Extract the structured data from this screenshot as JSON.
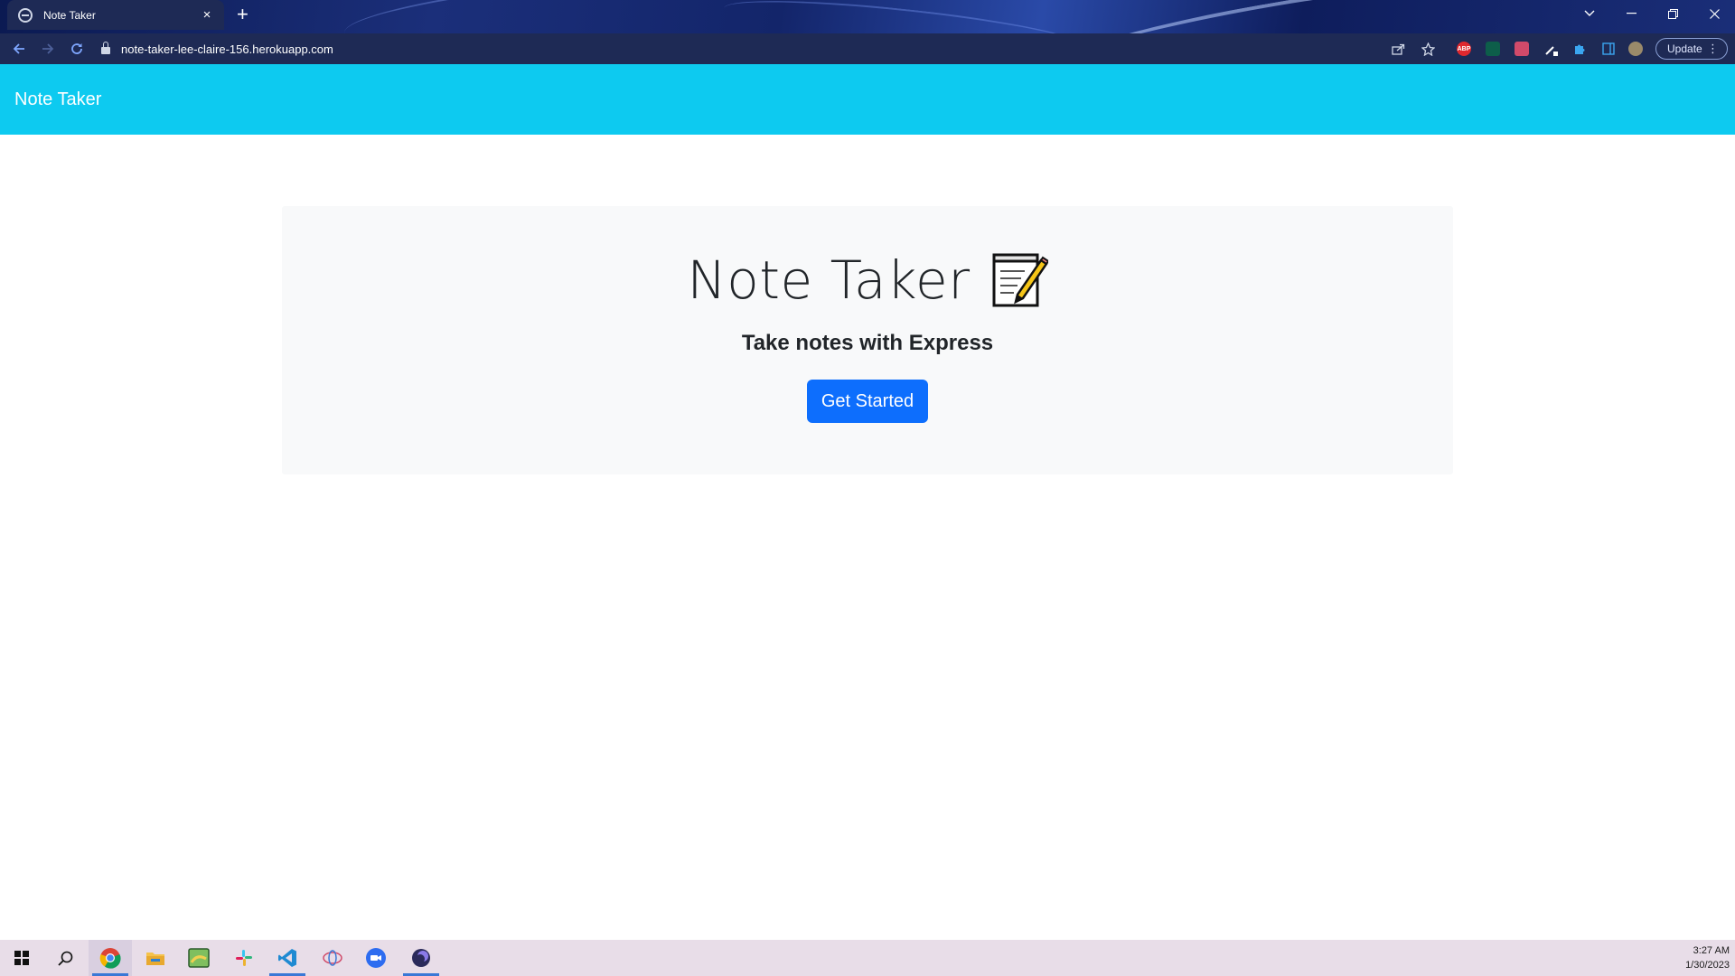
{
  "browser": {
    "tab_title": "Note Taker",
    "tab_close": "×",
    "new_tab": "+",
    "url": "note-taker-lee-claire-156.herokuapp.com",
    "update_label": "Update",
    "menu_dots": "⋮",
    "extensions": [
      "ABP"
    ]
  },
  "page": {
    "navbar_brand": "Note Taker",
    "title": "Note Taker",
    "title_emoji": "memo-icon",
    "subtitle": "Take notes with Express",
    "cta_label": "Get Started",
    "colors": {
      "navbar": "#0dcaf0",
      "jumbotron": "#f8f9fa",
      "button": "#0d6efd"
    }
  },
  "taskbar": {
    "time": "3:27 AM",
    "date": "1/30/2023",
    "apps": [
      "start-icon",
      "search-icon",
      "chrome-icon",
      "file-explorer-icon",
      "maps-icon",
      "slack-icon",
      "vscode-icon",
      "network-icon",
      "zoom-icon",
      "app-icon"
    ]
  }
}
